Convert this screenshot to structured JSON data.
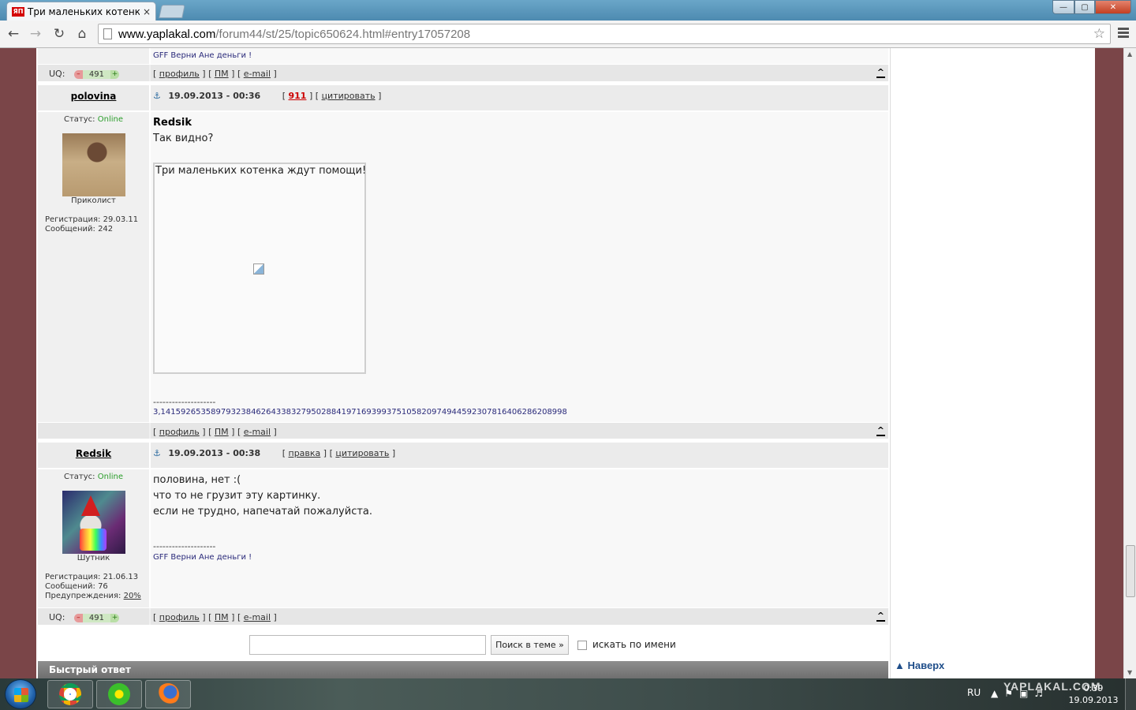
{
  "browser": {
    "tab_title": "Три маленьких котенка",
    "tab_close": "×",
    "favicon_text": "ЯП",
    "url_host": "www.yaplakal.com",
    "url_path": "/forum44/st/25/topic650624.html#entry17057208",
    "win_min": "—",
    "win_max": "▢",
    "win_close": "✕"
  },
  "prev_post": {
    "signature": "GFF Верни Ане деньги !",
    "uq_label": "UQ:",
    "reputation": "491"
  },
  "common": {
    "rep_minus": "–",
    "rep_plus": "+",
    "open_bracket": "[",
    "close_bracket": "]",
    "profile_link": "профиль",
    "pm_link": "ПМ",
    "email_link": "e-mail",
    "to_top": "^",
    "status_label": "Статус:",
    "status_online": "Online",
    "quote_link": "цитировать",
    "edit_link": "правка",
    "reg_label": "Регистрация:",
    "msgs_label": "Сообщений:",
    "warn_label": "Предупреждения:",
    "sig_separator": "--------------------"
  },
  "posts": [
    {
      "author": "polovina",
      "date": "19.09.2013 - 00:36",
      "karma": "911",
      "rank": "Приколист",
      "registered": "29.03.11",
      "messages": "242",
      "text_bold": "Redsik",
      "text_lines": [
        "Так видно?"
      ],
      "image_alt": "Три маленьких котенка ждут помощи!",
      "signature": "3,14159265358979323846264338327950288419716939937510582097494459230781640628620899​8"
    },
    {
      "author": "Redsik",
      "date": "19.09.2013 - 00:38",
      "rank": "Шутник",
      "registered": "21.06.13",
      "messages": "76",
      "warnings": "20%",
      "text_lines": [
        "половина, нет :(",
        "что то не грузит эту картинку.",
        "если не трудно, напечатай пожалуйста."
      ],
      "signature": "GFF Верни Ане деньги !",
      "uq_label": "UQ:",
      "reputation": "491"
    }
  ],
  "search": {
    "input_value": "",
    "button_label": "Поиск в теме »",
    "checkbox_label": "искать по имени"
  },
  "quick_reply_title": "Быстрый ответ",
  "to_top_link": "Наверх",
  "taskbar": {
    "lang": "RU",
    "time": "0:39",
    "date": "19.09.2013",
    "watermark": "YAPLAKAL.COM"
  }
}
